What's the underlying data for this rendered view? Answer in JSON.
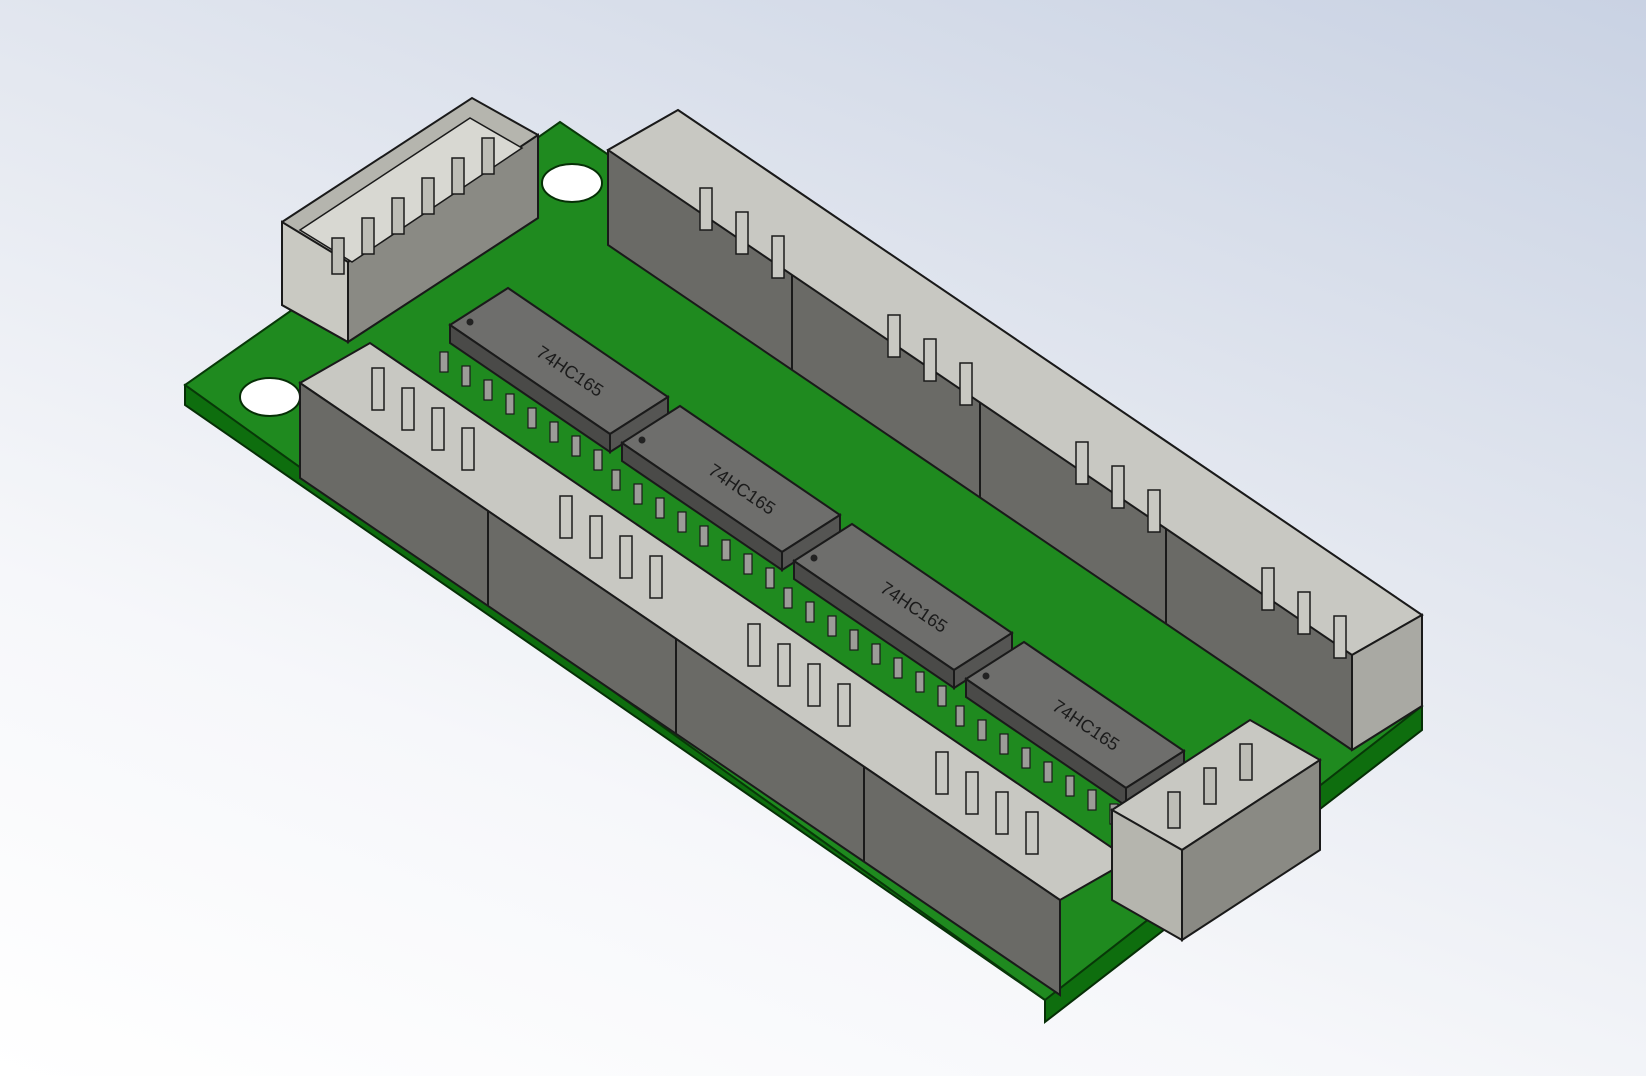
{
  "chips": [
    {
      "marking": "74HC165"
    },
    {
      "marking": "74HC165"
    },
    {
      "marking": "74HC165"
    },
    {
      "marking": "74HC165"
    }
  ],
  "colors": {
    "pcb_top": "#1f8a1f",
    "pcb_edge": "#0e6e0e",
    "connector_body": "#c8c8c2",
    "connector_shadow": "#6a6a66",
    "chip_body": "#5a5a5a",
    "pin": "#9c9c98"
  }
}
